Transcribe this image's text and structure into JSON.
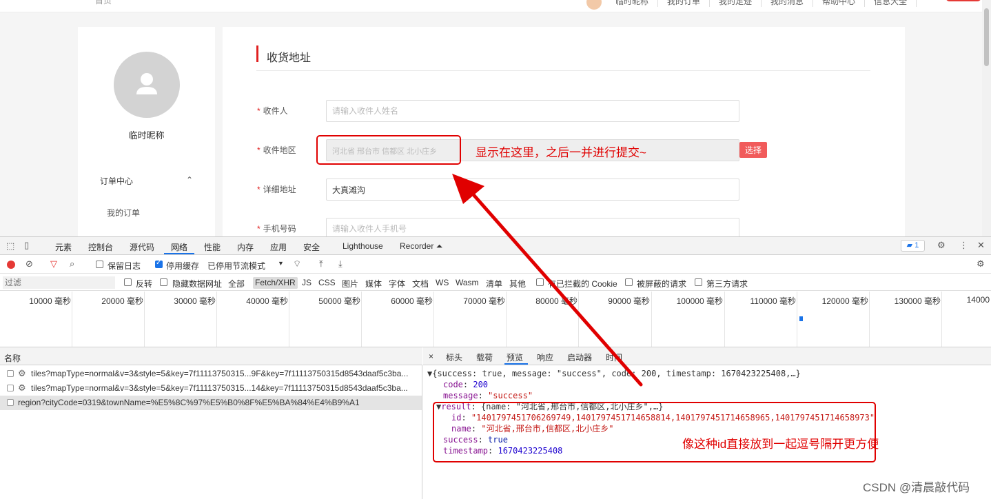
{
  "page": {
    "topbar": {
      "home": "首页",
      "links": [
        "临时昵称",
        "我的订单",
        "我的足迹",
        "我的消息",
        "帮助中心",
        "信息大全"
      ]
    },
    "sidebar": {
      "username": "临时昵称",
      "menu_head": "订单中心",
      "menu_caret": "⌃",
      "menu_sub": "我的订单"
    },
    "form": {
      "title": "收货地址",
      "receiver_label": "收件人",
      "receiver_placeholder": "请输入收件人姓名",
      "region_label": "收件地区",
      "region_value": "河北省 邢台市 信都区 北小庄乡",
      "select_button": "选择",
      "address_label": "详细地址",
      "address_value": "大真滩沟",
      "phone_label": "手机号码",
      "phone_placeholder": "请输入收件人手机号",
      "required_mark": "*"
    }
  },
  "devtools": {
    "tabs": [
      "元素",
      "控制台",
      "源代码",
      "网络",
      "性能",
      "内存",
      "应用",
      "安全",
      "Lighthouse",
      "Recorder ⏶"
    ],
    "active_tab": "网络",
    "message_count": "1",
    "toolbar": {
      "preserve_log": "保留日志",
      "disable_cache": "停用缓存",
      "throttle": "已停用节流模式",
      "throttle_caret": "▼"
    },
    "filter": {
      "placeholder": "过滤",
      "invert": "反转",
      "hide_data_urls": "隐藏数据网址",
      "types": [
        "全部",
        "Fetch/XHR",
        "JS",
        "CSS",
        "图片",
        "媒体",
        "字体",
        "文档",
        "WS",
        "Wasm",
        "清单",
        "其他"
      ],
      "selected_type": "Fetch/XHR",
      "blocked_cookies": "有已拦截的 Cookie",
      "blocked_requests": "被屏蔽的请求",
      "third_party": "第三方请求"
    },
    "timeline_labels": [
      "10000 毫秒",
      "20000 毫秒",
      "30000 毫秒",
      "40000 毫秒",
      "50000 毫秒",
      "60000 毫秒",
      "70000 毫秒",
      "80000 毫秒",
      "90000 毫秒",
      "100000 毫秒",
      "110000 毫秒",
      "120000 毫秒",
      "130000 毫秒",
      "14000"
    ],
    "requests": {
      "header": "名称",
      "rows": [
        "tiles?mapType=normal&v=3&style=5&key=7f11113750315...9F&key=7f11113750315d8543daaf5c3ba...",
        "tiles?mapType=normal&v=3&style=5&key=7f11113750315...14&key=7f11113750315d8543daaf5c3ba...",
        "region?cityCode=0319&townName=%E5%8C%97%E5%B0%8F%E5%BA%84%E4%B9%A1"
      ]
    },
    "detail": {
      "close": "×",
      "tabs": [
        "标头",
        "载荷",
        "预览",
        "响应",
        "启动器",
        "时间"
      ],
      "active_tab": "预览",
      "json": {
        "summary": "{success: true, message: \"success\", code: 200, timestamp: 1670423225408,…}",
        "code_key": "code",
        "code_val": "200",
        "message_key": "message",
        "message_val": "\"success\"",
        "result_summary_key": "result",
        "result_summary_val": "{name: \"河北省,邢台市,信都区,北小庄乡\",…}",
        "id_key": "id",
        "id_val": "\"1401797451706269749,1401797451714658814,1401797451714658965,1401797451714658973\"",
        "name_key": "name",
        "name_val": "\"河北省,邢台市,信都区,北小庄乡\"",
        "success_key": "success",
        "success_val": "true",
        "timestamp_key": "timestamp",
        "timestamp_val": "1670423225408"
      }
    }
  },
  "annotations": {
    "note1": "显示在这里，之后一并进行提交~",
    "note2": "像这种id直接放到一起逗号隔开更方便",
    "color": "#e00000"
  },
  "watermark": "CSDN @清晨敲代码"
}
